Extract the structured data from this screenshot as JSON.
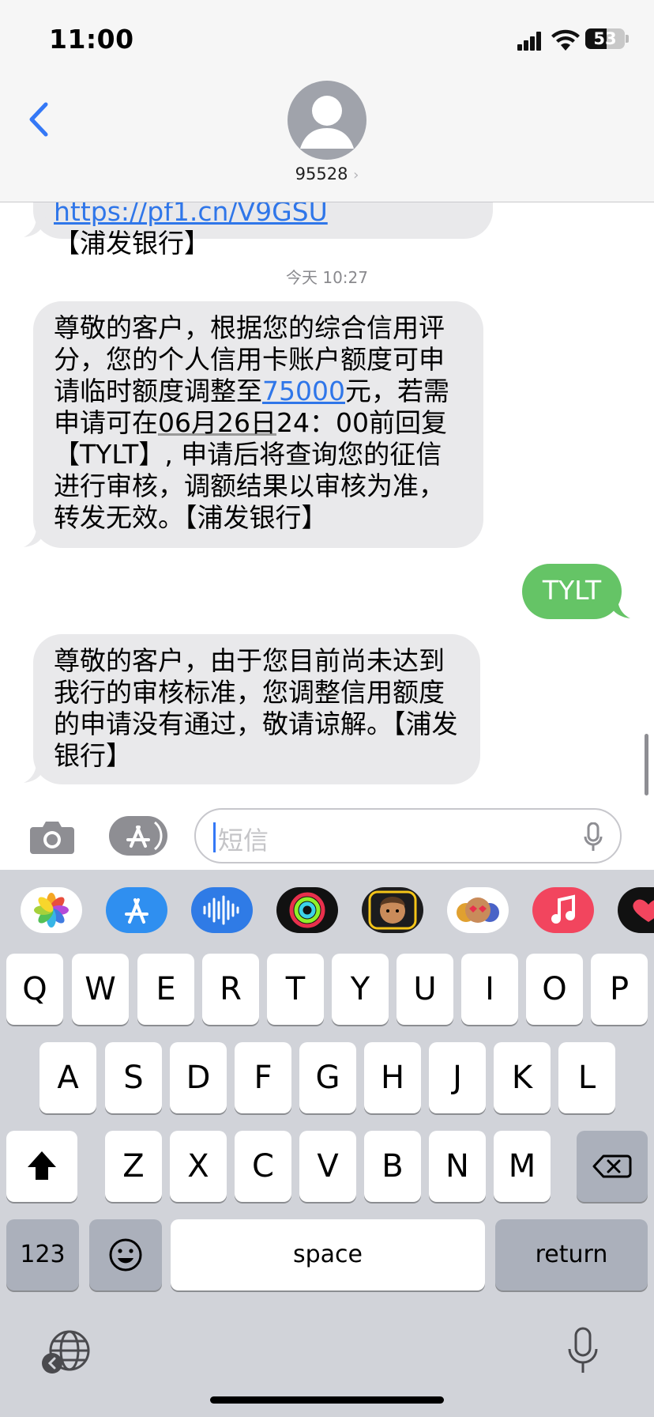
{
  "status_bar": {
    "time": "11:00",
    "battery": "53",
    "battery_level": 0.53
  },
  "header": {
    "contact": "95528"
  },
  "messages": {
    "prev_link": "https://pf1.cn/V9GSU",
    "prev_tail": "【浦发银行】",
    "timestamp": "今天 10:27",
    "msg1_part1": "尊敬的客户，根据您的综合信用评分，您的个人信用卡账户额度可申请临时额度调整至",
    "msg1_amount": "75000",
    "msg1_part2": "元，若需申请可在",
    "msg1_date": "06月26日",
    "msg1_part3": "24：00前回复【TYLT】, 申请后将查询您的征信进行审核，调额结果以审核为准，转发无效。【浦发银行】",
    "reply": "TYLT",
    "msg2": "尊敬的客户，由于您目前尚未达到我行的审核标准，您调整信用额度的申请没有通过，敬请谅解。【浦发银行】"
  },
  "input": {
    "placeholder": "短信"
  },
  "keyboard": {
    "row1": [
      "Q",
      "W",
      "E",
      "R",
      "T",
      "Y",
      "U",
      "I",
      "O",
      "P"
    ],
    "row2": [
      "A",
      "S",
      "D",
      "F",
      "G",
      "H",
      "J",
      "K",
      "L"
    ],
    "row3": [
      "Z",
      "X",
      "C",
      "V",
      "B",
      "N",
      "M"
    ],
    "numbers": "123",
    "space": "space",
    "return": "return"
  },
  "apps": [
    "photos",
    "app-store",
    "audio",
    "activity",
    "memoji",
    "animoji",
    "music",
    "heart"
  ],
  "colors": {
    "incoming": "#e9e9eb",
    "outgoing": "#65c466",
    "link": "#2f76e9",
    "accent": "#3478f6"
  }
}
